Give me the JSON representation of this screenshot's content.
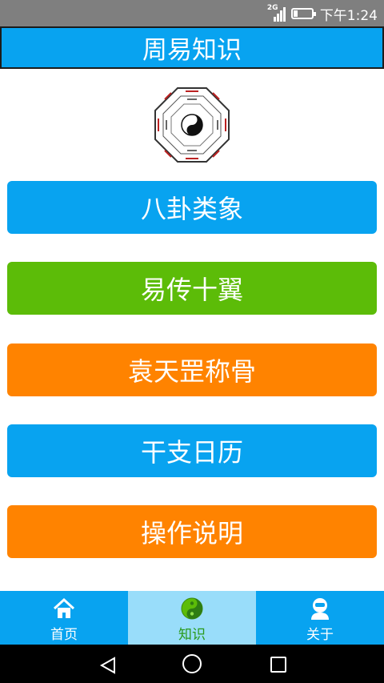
{
  "status_bar": {
    "network": "2G",
    "time": "下午1:24"
  },
  "header": {
    "title": "周易知识"
  },
  "image": {
    "icon": "bagua-icon"
  },
  "menu": [
    {
      "label": "八卦类象",
      "color": "#08a3f0"
    },
    {
      "label": "易传十翼",
      "color": "#5cbc08"
    },
    {
      "label": "袁天罡称骨",
      "color": "#ff8300"
    },
    {
      "label": "干支日历",
      "color": "#08a3f0"
    },
    {
      "label": "操作说明",
      "color": "#ff8300"
    }
  ],
  "tabs": [
    {
      "label": "首页",
      "icon": "home-icon",
      "active": false
    },
    {
      "label": "知识",
      "icon": "yin-yang-icon",
      "active": true
    },
    {
      "label": "关于",
      "icon": "user-icon",
      "active": false
    }
  ],
  "colors": {
    "primary": "#08a3f0",
    "green": "#5cbc08",
    "orange": "#ff8300",
    "tab_active_bg": "#99ddfa"
  }
}
